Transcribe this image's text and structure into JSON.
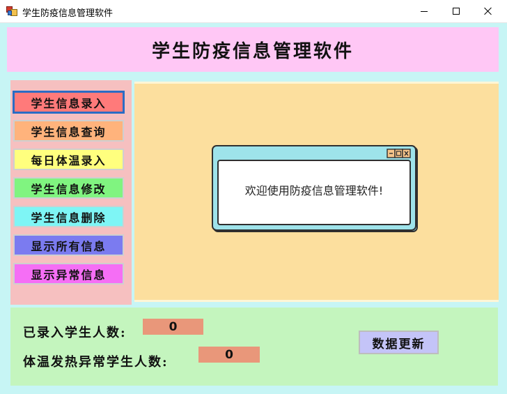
{
  "window": {
    "title": "学生防疫信息管理软件"
  },
  "header": {
    "title": "学生防疫信息管理软件"
  },
  "nav": [
    {
      "label": "学生信息录入",
      "color": "#ff7a7a",
      "selected": true
    },
    {
      "label": "学生信息查询",
      "color": "#ffb37c",
      "selected": false
    },
    {
      "label": "每日体温录入",
      "color": "#ffff7e",
      "selected": false
    },
    {
      "label": "学生信息修改",
      "color": "#80f480",
      "selected": false
    },
    {
      "label": "学生信息删除",
      "color": "#7ef5f5",
      "selected": false
    },
    {
      "label": "显示所有信息",
      "color": "#7b7bf0",
      "selected": false
    },
    {
      "label": "显示异常信息",
      "color": "#f56ef5",
      "selected": false
    }
  ],
  "welcome": {
    "message": "欢迎使用防疫信息管理软件!"
  },
  "stats": {
    "registered_label": "已录入学生人数:",
    "registered_value": "0",
    "fever_label": "体温发热异常学生人数:",
    "fever_value": "0"
  },
  "refresh_button": {
    "label": "数据更新"
  },
  "colors": {
    "header_bg": "#ffc7f5",
    "client_bg": "#c7f5f5",
    "menu_bg": "#f6c0c0",
    "content_bg": "#fcdf9e",
    "bottom_bg": "#c4f5be",
    "value_bg": "#e9977a",
    "refresh_bg": "#c4c4f8"
  }
}
